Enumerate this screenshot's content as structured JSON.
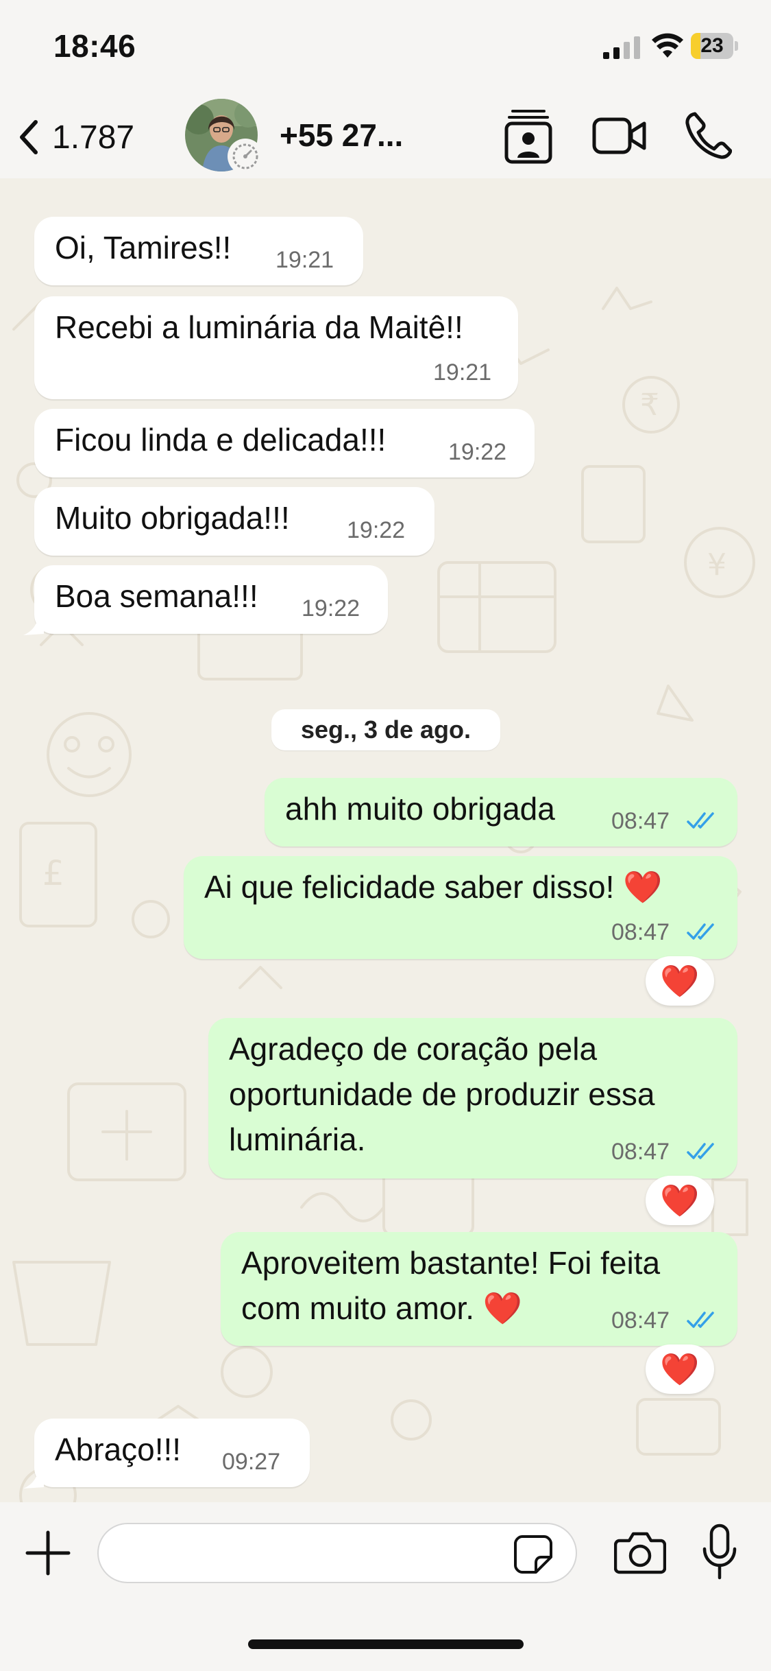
{
  "status_bar": {
    "time": "18:46",
    "battery_level": "23",
    "battery_fraction": 0.23,
    "icons": [
      "signal-icon",
      "wifi-icon",
      "battery-icon"
    ]
  },
  "header": {
    "back_count": "1.787",
    "contact_name": "+55 27...",
    "icons": [
      "chevron-left-icon",
      "avatar",
      "timer-icon",
      "contact-card-icon",
      "video-call-icon",
      "phone-icon"
    ]
  },
  "messages": [
    {
      "direction": "incoming",
      "text": "Oi, Tamires!!",
      "time": "19:21"
    },
    {
      "direction": "incoming",
      "text": "Recebi a luminária da Maitê!!",
      "time": "19:21"
    },
    {
      "direction": "incoming",
      "text": "Ficou linda e delicada!!!",
      "time": "19:22"
    },
    {
      "direction": "incoming",
      "text": "Muito obrigada!!!",
      "time": "19:22"
    },
    {
      "direction": "incoming",
      "text": "Boa semana!!!",
      "time": "19:22"
    },
    {
      "direction": "outgoing",
      "text": "ahh muito obrigada",
      "time": "08:47"
    },
    {
      "direction": "outgoing",
      "text": "Ai que felicidade saber disso! ❤️",
      "time": "08:47",
      "reaction": "❤️"
    },
    {
      "direction": "outgoing",
      "text": "Agradeço de coração pela\noportunidade de produzir essa\nluminária.",
      "time": "08:47",
      "reaction": "❤️"
    },
    {
      "direction": "outgoing",
      "text": "Aproveitem bastante! Foi feita\ncom muito amor. ❤️",
      "time": "08:47",
      "reaction": "❤️"
    },
    {
      "direction": "incoming",
      "text": "Abraço!!!",
      "time": "09:27"
    }
  ],
  "date_separator": "seg., 3 de ago.",
  "input": {
    "placeholder": "",
    "value": "",
    "icons": [
      "plus-icon",
      "sticker-icon",
      "camera-icon",
      "microphone-icon"
    ]
  },
  "colors": {
    "incoming_bubble": "#ffffff",
    "outgoing_bubble": "#d9fdd3",
    "read_ticks": "#34a0e8",
    "chat_background": "#f2efe7",
    "battery_fill": "#f7ce2c"
  }
}
